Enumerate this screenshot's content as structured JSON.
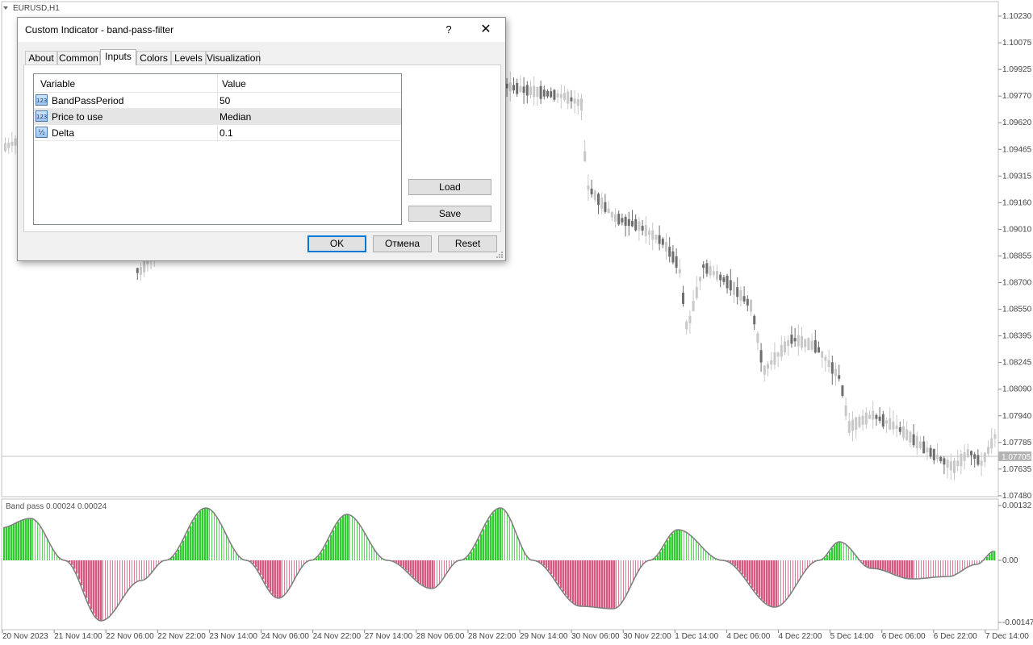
{
  "chart": {
    "symbol": "EURUSD,H1",
    "current_price": "1.07705",
    "price_ticks": [
      "1.10230",
      "1.10075",
      "1.09925",
      "1.09770",
      "1.09620",
      "1.09465",
      "1.09315",
      "1.09160",
      "1.09010",
      "1.08855",
      "1.08700",
      "1.08550",
      "1.08395",
      "1.08245",
      "1.08090",
      "1.07940",
      "1.07785",
      "1.07635",
      "1.07480"
    ],
    "indicator_label": "Band pass  0.00024 0.00024",
    "indicator_ticks": [
      "0.00132",
      "0.00",
      "-0.00147"
    ],
    "time_ticks": [
      "20 Nov 2023",
      "21 Nov 14:00",
      "22 Nov 06:00",
      "22 Nov 22:00",
      "23 Nov 14:00",
      "24 Nov 06:00",
      "24 Nov 22:00",
      "27 Nov 14:00",
      "28 Nov 06:00",
      "28 Nov 22:00",
      "29 Nov 14:00",
      "30 Nov 06:00",
      "30 Nov 22:00",
      "1 Dec 14:00",
      "4 Dec 06:00",
      "4 Dec 22:00",
      "5 Dec 14:00",
      "6 Dec 06:00",
      "6 Dec 22:00",
      "7 Dec 14:00"
    ],
    "colors": {
      "bull": "#c8c8c8",
      "bear": "#6e6e6e",
      "positive": "#2ecc2e",
      "negative": "#d9577f",
      "line": "#808080"
    }
  },
  "dialog": {
    "title": "Custom Indicator - band-pass-filter",
    "help_label": "?",
    "close_label": "✕",
    "tabs": [
      "About",
      "Common",
      "Inputs",
      "Colors",
      "Levels",
      "Visualization"
    ],
    "active_tab": "Inputs",
    "grid": {
      "headers": [
        "Variable",
        "Value"
      ],
      "rows": [
        {
          "icon": "123",
          "name": "BandPassPeriod",
          "value": "50"
        },
        {
          "icon": "123",
          "name": "Price to use",
          "value": "Median"
        },
        {
          "icon": "½",
          "name": "Delta",
          "value": "0.1"
        }
      ]
    },
    "buttons": {
      "load": "Load",
      "save": "Save",
      "ok": "OK",
      "cancel": "Отмена",
      "reset": "Reset"
    }
  }
}
